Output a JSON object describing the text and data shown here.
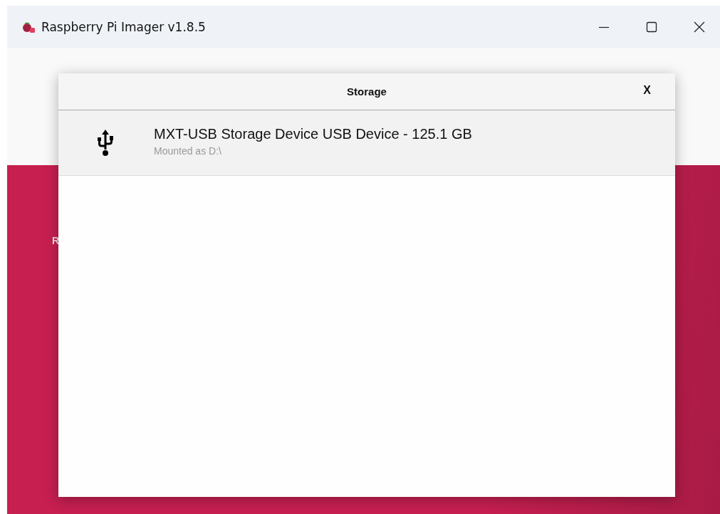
{
  "window": {
    "title": "Raspberry Pi Imager v1.8.5"
  },
  "background": {
    "text_fragment": "R"
  },
  "dialog": {
    "title": "Storage",
    "close": "X",
    "devices": [
      {
        "kind": "usb",
        "name": "MXT-USB Storage Device USB Device - 125.1 GB",
        "detail": "Mounted as D:\\",
        "selected": true
      }
    ]
  }
}
